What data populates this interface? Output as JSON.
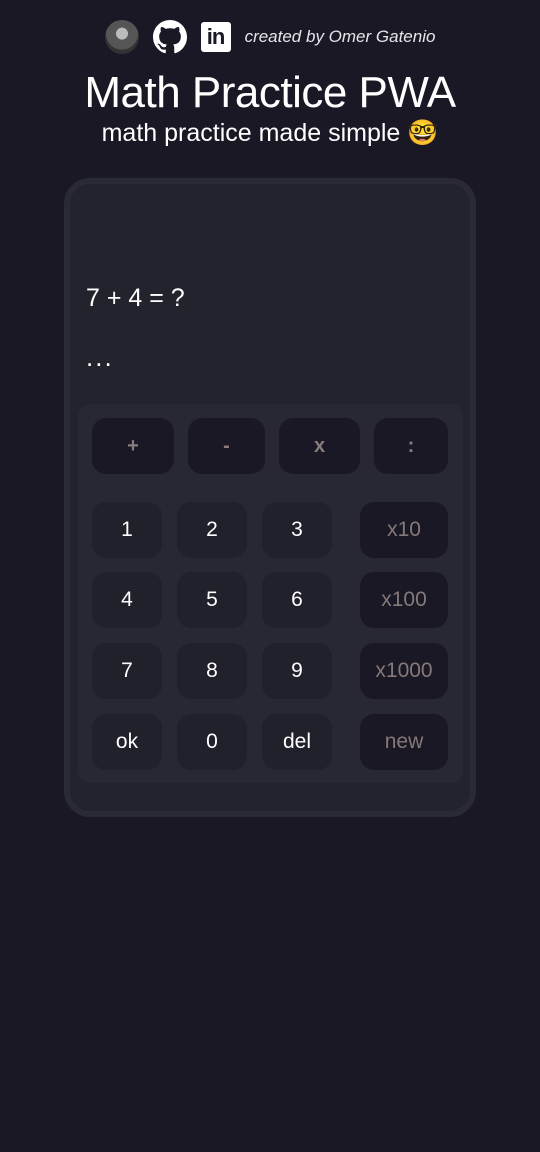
{
  "header": {
    "credit": "created by Omer Gatenio",
    "title": "Math Practice PWA",
    "subtitle": "math practice made simple 🤓",
    "linkedin_label": "in"
  },
  "display": {
    "question": "7 + 4 = ?",
    "answer": "..."
  },
  "operators": [
    "+",
    "-",
    "x",
    ":"
  ],
  "keys": [
    [
      "1",
      "2",
      "3",
      "x10"
    ],
    [
      "4",
      "5",
      "6",
      "x100"
    ],
    [
      "7",
      "8",
      "9",
      "x1000"
    ],
    [
      "ok",
      "0",
      "del",
      "new"
    ]
  ],
  "colors": {
    "background": "#1a1825",
    "card": "#23232e",
    "muted_text": "#8a7c7c"
  }
}
